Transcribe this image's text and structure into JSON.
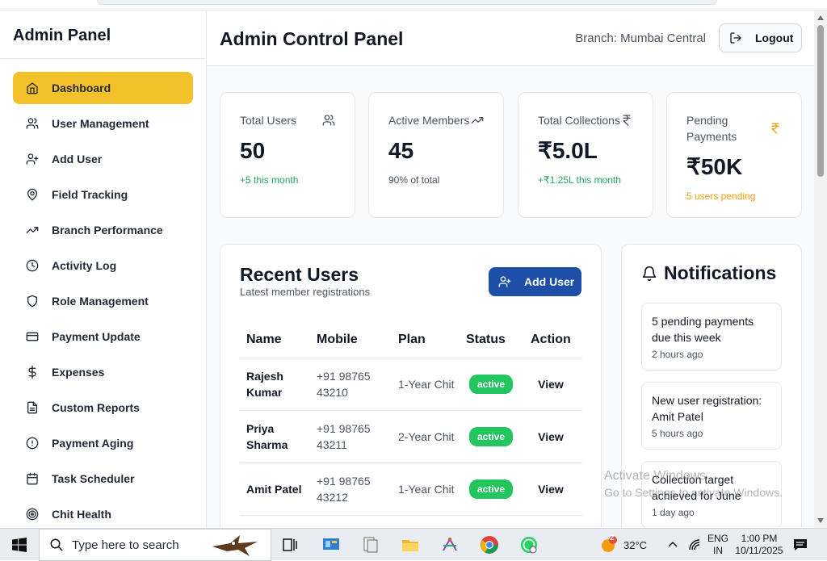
{
  "sidebar": {
    "title": "Admin Panel",
    "items": [
      {
        "label": "Dashboard",
        "icon": "home-icon",
        "active": true
      },
      {
        "label": "User Management",
        "icon": "users-icon"
      },
      {
        "label": "Add User",
        "icon": "user-plus-icon"
      },
      {
        "label": "Field Tracking",
        "icon": "map-pin-icon"
      },
      {
        "label": "Branch Performance",
        "icon": "trending-up-icon"
      },
      {
        "label": "Activity Log",
        "icon": "clock-icon"
      },
      {
        "label": "Role Management",
        "icon": "shield-icon"
      },
      {
        "label": "Payment Update",
        "icon": "credit-card-icon"
      },
      {
        "label": "Expenses",
        "icon": "dollar-icon"
      },
      {
        "label": "Custom Reports",
        "icon": "file-text-icon"
      },
      {
        "label": "Payment Aging",
        "icon": "alert-circle-icon"
      },
      {
        "label": "Task Scheduler",
        "icon": "calendar-icon"
      },
      {
        "label": "Chit Health",
        "icon": "target-icon"
      }
    ]
  },
  "header": {
    "title": "Admin Control Panel",
    "branch": "Branch: Mumbai Central",
    "logout_label": "Logout"
  },
  "stats": [
    {
      "label": "Total Users",
      "value": "50",
      "sub": "+5 this month",
      "icon": "users-icon",
      "tone": "green"
    },
    {
      "label": "Active Members",
      "value": "45",
      "sub": "90% of total",
      "icon": "trending-up-icon",
      "tone": "grey"
    },
    {
      "label": "Total Collections",
      "value": "₹5.0L",
      "sub": "+₹1.25L this month",
      "icon": "rupee-icon",
      "tone": "green"
    },
    {
      "label": "Pending Payments",
      "value": "₹50K",
      "sub": "5 users pending",
      "icon": "rupee-icon",
      "tone": "orange"
    }
  ],
  "recent_users": {
    "title": "Recent Users",
    "subtitle": "Latest member registrations",
    "add_button": "Add User",
    "columns": [
      "Name",
      "Mobile",
      "Plan",
      "Status",
      "Action"
    ],
    "rows": [
      {
        "name": "Rajesh Kumar",
        "mobile": "+91 98765 43210",
        "plan": "1-Year Chit",
        "status": "active",
        "action": "View"
      },
      {
        "name": "Priya Sharma",
        "mobile": "+91 98765 43211",
        "plan": "2-Year Chit",
        "status": "active",
        "action": "View"
      },
      {
        "name": "Amit Patel",
        "mobile": "+91 98765 43212",
        "plan": "1-Year Chit",
        "status": "active",
        "action": "View"
      }
    ]
  },
  "notifications": {
    "title": "Notifications",
    "items": [
      {
        "message": "5 pending payments due this week",
        "time": "2 hours ago"
      },
      {
        "message": "New user registration: Amit Patel",
        "time": "5 hours ago"
      },
      {
        "message": "Collection target achieved for June",
        "time": "1 day ago"
      }
    ]
  },
  "watermark": {
    "line1": "Activate Windows",
    "line2": "Go to Settings to activate Windows."
  },
  "taskbar": {
    "search_placeholder": "Type here to search",
    "weather": "32°C",
    "weather_badge": "2",
    "lang": "ENG",
    "region": "IN",
    "time": "1:00 PM",
    "date": "10/11/2025"
  },
  "colors": {
    "accent": "#f5c12b",
    "primary": "#1d4ea8",
    "success": "#22c55e"
  }
}
